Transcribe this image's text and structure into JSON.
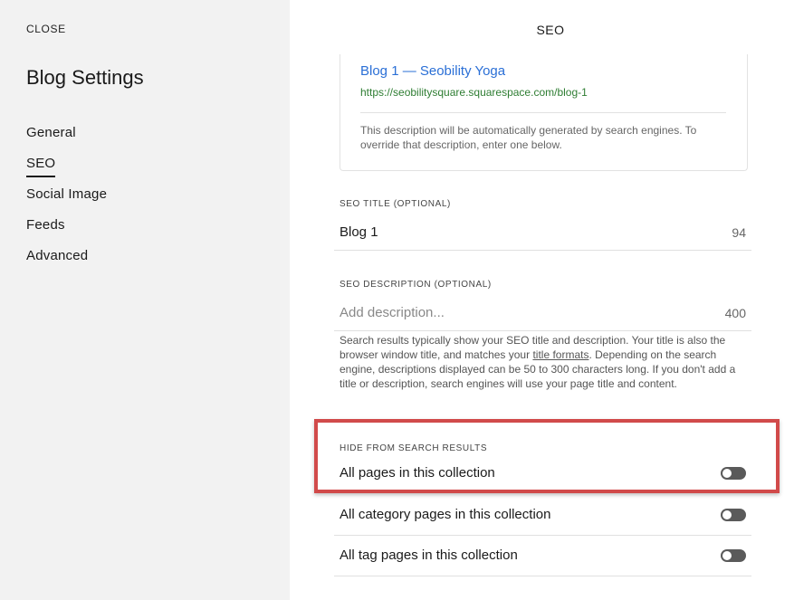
{
  "sidebar": {
    "close_label": "CLOSE",
    "title": "Blog Settings",
    "items": [
      {
        "label": "General",
        "active": false
      },
      {
        "label": "SEO",
        "active": true
      },
      {
        "label": "Social Image",
        "active": false
      },
      {
        "label": "Feeds",
        "active": false
      },
      {
        "label": "Advanced",
        "active": false
      }
    ]
  },
  "main": {
    "title": "SEO",
    "preview": {
      "link_text": "Blog 1 — Seobility Yoga",
      "url": "https://seobilitysquare.squarespace.com/blog-1",
      "description": "This description will be automatically generated by search engines. To override that description, enter one below."
    },
    "seo_title": {
      "label": "SEO TITLE (OPTIONAL)",
      "value": "Blog 1",
      "count": "94"
    },
    "seo_description": {
      "label": "SEO DESCRIPTION (OPTIONAL)",
      "placeholder": "Add description...",
      "count": "400"
    },
    "help": {
      "before_link": "Search results typically show your SEO title and description. Your title is also the browser window title, and matches your ",
      "link": "title formats",
      "after_link": ". Depending on the search engine, descriptions displayed can be 50 to 300 characters long. If you don't add a title or description, search engines will use your page title and content."
    },
    "hide_section": {
      "label": "HIDE FROM SEARCH RESULTS",
      "toggles": [
        {
          "label": "All pages in this collection",
          "on": false
        },
        {
          "label": "All category pages in this collection",
          "on": false
        },
        {
          "label": "All tag pages in this collection",
          "on": false
        }
      ]
    }
  },
  "colors": {
    "sidebar_bg": "#f2f2f2",
    "link_blue": "#2a6fd6",
    "url_green": "#2e7d32",
    "highlight_red": "#d14a4a",
    "toggle_off": "#5a5a5a"
  }
}
